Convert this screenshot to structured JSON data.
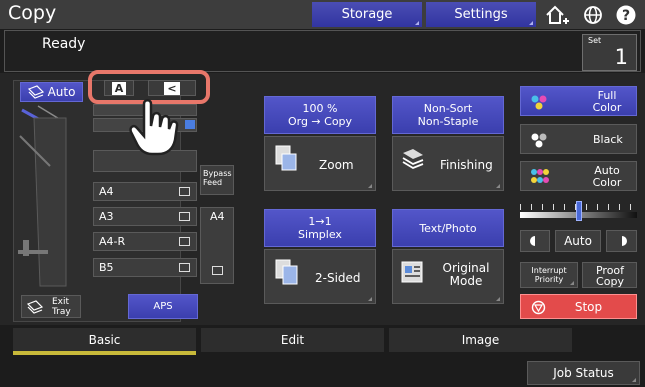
{
  "header": {
    "title": "Copy",
    "storage_label": "Storage",
    "settings_label": "Settings"
  },
  "status": {
    "message": "Ready",
    "set_label": "Set",
    "set_value": "1"
  },
  "paper": {
    "auto_label": "Auto",
    "orientation": [
      "A",
      "<"
    ],
    "trays": [
      "A4",
      "A3",
      "A4-R",
      "B5"
    ],
    "bypass_label": "Bypass\nFeed",
    "bypass_size": "A4",
    "exit_tray_label": "Exit\nTray",
    "aps_label": "APS"
  },
  "ratio": {
    "line1": "100 %",
    "line2": "Org → Copy",
    "zoom_label": "Zoom"
  },
  "finishing": {
    "line1": "Non-Sort",
    "line2": "Non-Staple",
    "finishing_label": "Finishing"
  },
  "duplex": {
    "line1": "1→1",
    "line2": "Simplex",
    "two_sided_label": "2-Sided"
  },
  "original": {
    "mode_text": "Text/Photo",
    "mode_label_1": "Original",
    "mode_label_2": "Mode"
  },
  "color": {
    "full_1": "Full",
    "full_2": "Color",
    "black": "Black",
    "auto_1": "Auto",
    "auto_2": "Color"
  },
  "density": {
    "auto_label": "Auto",
    "level": 0.5
  },
  "actions": {
    "interrupt_1": "Interrupt",
    "interrupt_2": "Priority",
    "proof_1": "Proof",
    "proof_2": "Copy",
    "stop": "Stop"
  },
  "tabs": [
    "Basic",
    "Edit",
    "Image"
  ],
  "footer": {
    "job_status": "Job Status"
  },
  "colors": {
    "accent_blue": "#4a4dbf",
    "stop_red": "#e34b4b",
    "active_tab": "#c8b93a",
    "highlight": "#e8776a"
  }
}
